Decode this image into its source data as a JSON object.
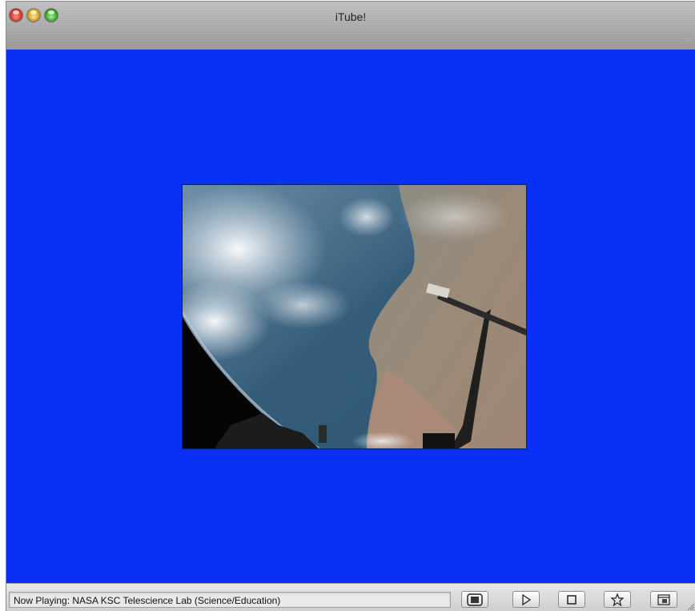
{
  "window": {
    "title": "iTube!",
    "stage_color": "#0a2ff5",
    "traffic_lights": [
      "close-icon",
      "minimize-icon",
      "zoom-icon"
    ]
  },
  "video": {
    "content": "earth-from-space-image"
  },
  "statusbar": {
    "now_playing": "Now Playing: NASA KSC Telescience Lab (Science/Education)",
    "controls": [
      {
        "name": "fullscreen-button",
        "icon": "fullscreen-icon"
      },
      {
        "name": "play-button",
        "icon": "play-icon"
      },
      {
        "name": "stop-button",
        "icon": "stop-icon"
      },
      {
        "name": "favorite-button",
        "icon": "star-icon"
      },
      {
        "name": "window-button",
        "icon": "window-icon"
      }
    ]
  }
}
